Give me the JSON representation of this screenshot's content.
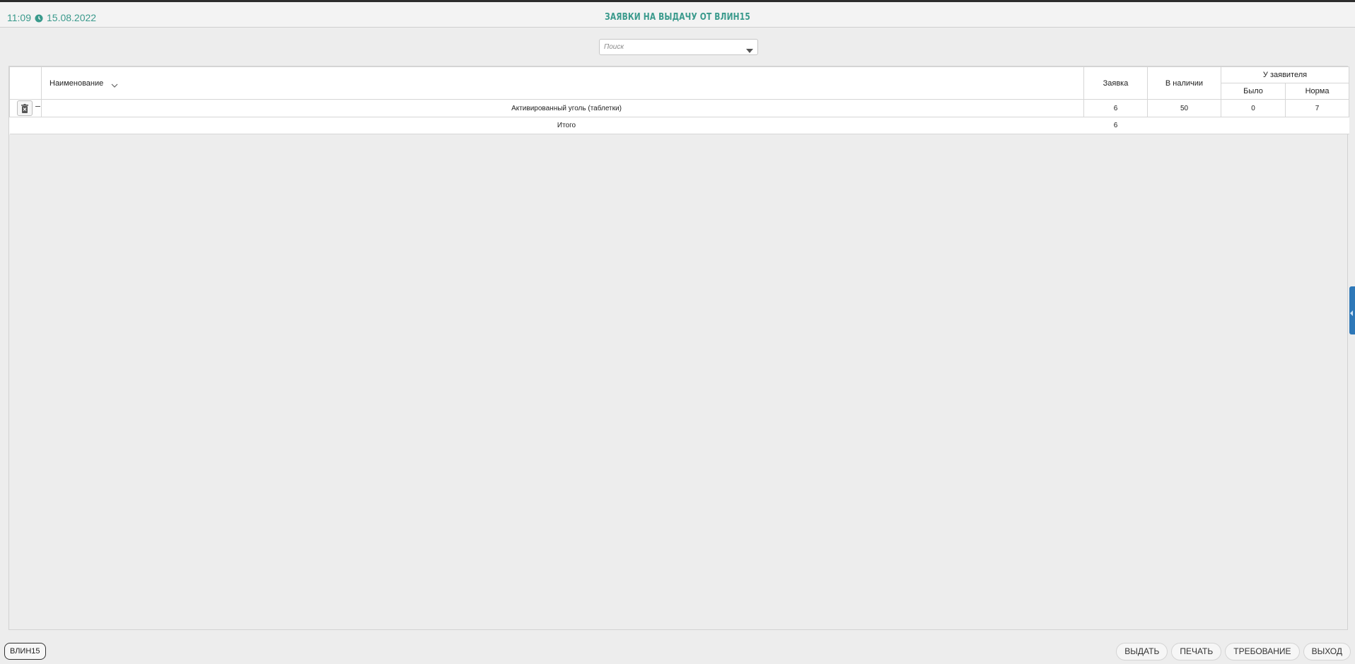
{
  "header": {
    "time": "11:09",
    "date": "15.08.2022",
    "title": "ЗАЯВКИ НА ВЫДАЧУ ОТ ВЛИН15",
    "accent_color": "#3a9a8c"
  },
  "search": {
    "placeholder": "Поиск"
  },
  "table": {
    "columns": {
      "name": "Наименование",
      "request": "Заявка",
      "in_stock": "В наличии",
      "applicant_group": "У заявителя",
      "was": "Было",
      "norm": "Норма"
    },
    "rows": [
      {
        "name": "Активированный уголь (таблетки)",
        "request": "6",
        "in_stock": "50",
        "was": "0",
        "norm": "7"
      }
    ],
    "total": {
      "label": "Итого",
      "request": "6"
    }
  },
  "footer": {
    "user_chip": "ВЛИН15",
    "buttons": {
      "issue": "ВЫДАТЬ",
      "print": "ПЕЧАТЬ",
      "requirement": "ТРЕБОВАНИЕ",
      "exit": "ВЫХОД"
    }
  },
  "icons": [
    "clock-icon",
    "dropdown-caret-icon",
    "sort-icon",
    "delete-icon",
    "side-panel-arrow-icon"
  ],
  "colors": {
    "side_tab": "#2e78b8"
  }
}
